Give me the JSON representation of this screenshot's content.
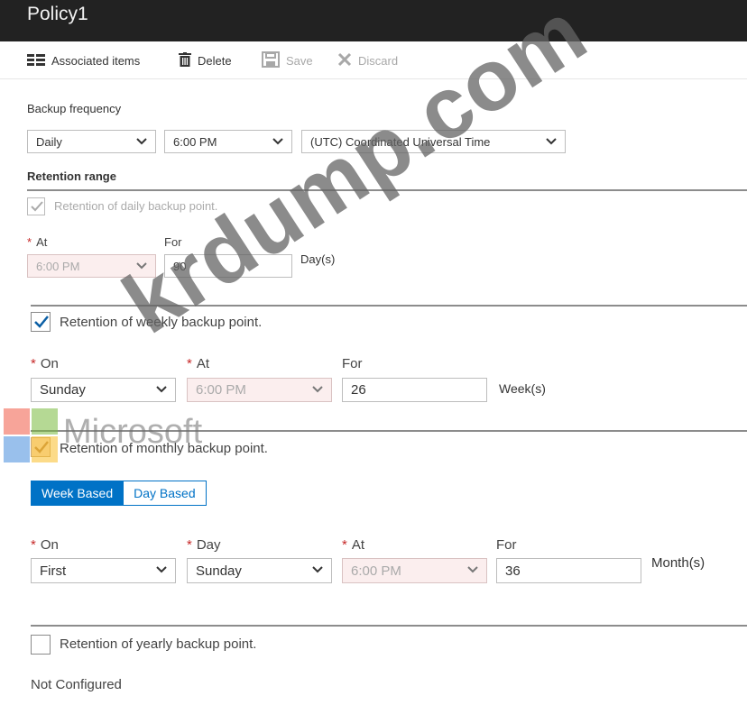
{
  "window": {
    "title": "Policy1"
  },
  "toolbar": {
    "associated_label": "Associated items",
    "delete_label": "Delete",
    "save_label": "Save",
    "discard_label": "Discard"
  },
  "backup_frequency": {
    "label": "Backup frequency",
    "frequency": "Daily",
    "time": "6:00 PM",
    "timezone": "(UTC) Coordinated Universal Time"
  },
  "retention": {
    "heading": "Retention range",
    "daily": {
      "label": "Retention of daily backup point.",
      "checked": true,
      "at_label": "At",
      "at_value": "6:00 PM",
      "for_label": "For",
      "for_value": "90",
      "unit": "Day(s)"
    },
    "weekly": {
      "label": "Retention of weekly backup point.",
      "checked": true,
      "on_label": "On",
      "on_value": "Sunday",
      "at_label": "At",
      "at_value": "6:00 PM",
      "for_label": "For",
      "for_value": "26",
      "unit": "Week(s)"
    },
    "monthly": {
      "label": "Retention of monthly backup point.",
      "checked": true,
      "toggle_week": "Week Based",
      "toggle_day": "Day Based",
      "on_label": "On",
      "on_value": "First",
      "day_label": "Day",
      "day_value": "Sunday",
      "at_label": "At",
      "at_value": "6:00 PM",
      "for_label": "For",
      "for_value": "36",
      "unit": "Month(s)"
    },
    "yearly": {
      "label": "Retention of yearly backup point.",
      "checked": false,
      "status": "Not Configured"
    }
  },
  "overlay": {
    "microsoft_text": "Microsoft",
    "watermark_text": "krdump.com"
  },
  "colors": {
    "titlebar": "#222222",
    "accent": "#0072c6",
    "required": "#c62828",
    "disabled_field": "#fbeeee"
  }
}
